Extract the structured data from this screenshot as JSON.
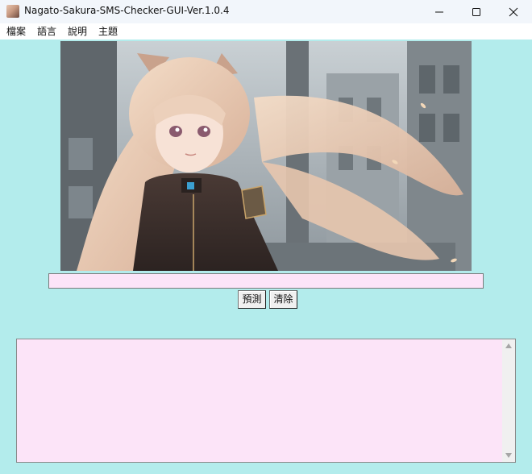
{
  "window": {
    "title": "Nagato-Sakura-SMS-Checker-GUI-Ver.1.0.4",
    "app_icon": "app-avatar-icon",
    "controls": [
      "minimize-icon",
      "maximize-icon",
      "close-icon"
    ]
  },
  "menu": {
    "items": [
      {
        "label": "檔案"
      },
      {
        "label": "語言"
      },
      {
        "label": "說明"
      },
      {
        "label": "主題"
      }
    ]
  },
  "hero_image": {
    "description_icon": "anime-illustration-image"
  },
  "input": {
    "value": "",
    "placeholder": ""
  },
  "buttons": {
    "predict_label": "預測",
    "clear_label": "清除"
  },
  "output": {
    "value": ""
  },
  "colors": {
    "background": "#b3ecec",
    "field_background": "#fce4f8",
    "button_face": "#f0f0f0"
  }
}
